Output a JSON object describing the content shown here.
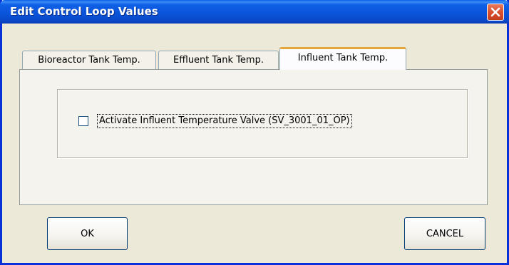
{
  "window": {
    "title": "Edit Control Loop Values",
    "close_icon": "close-icon"
  },
  "tabs": [
    {
      "label": "Bioreactor Tank Temp.",
      "active": false
    },
    {
      "label": "Effluent Tank Temp.",
      "active": false
    },
    {
      "label": "Influent Tank Temp.",
      "active": true
    }
  ],
  "panel": {
    "checkbox": {
      "label": "Activate Influent Temperature Valve (SV_3001_01_OP)",
      "checked": false
    }
  },
  "buttons": {
    "ok_label": "OK",
    "cancel_label": "CANCEL"
  },
  "colors": {
    "titlebar": "#0a53d8",
    "dialog_face": "#ece9d8",
    "active_tab_accent": "#e6a53a",
    "close_button": "#d8502f"
  }
}
